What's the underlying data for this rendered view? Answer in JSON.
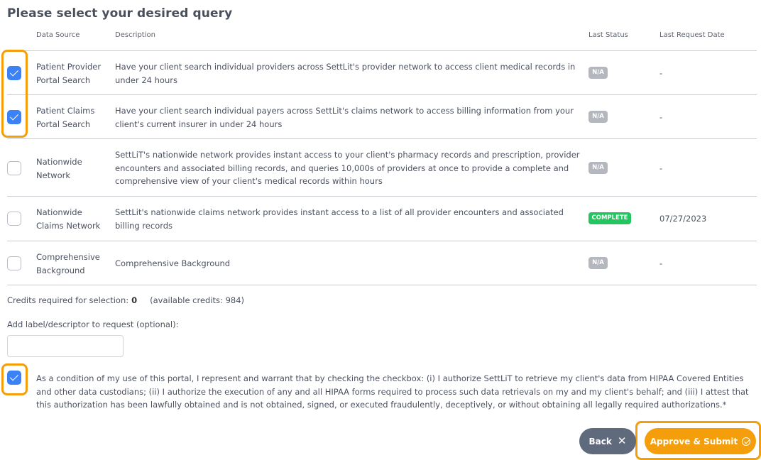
{
  "page": {
    "title": "Please select your desired query"
  },
  "table": {
    "headers": {
      "data_source": "Data Source",
      "description": "Description",
      "last_status": "Last Status",
      "last_request_date": "Last Request Date"
    },
    "rows": [
      {
        "data_source": "Patient Provider Portal Search",
        "description": "Have your client search individual providers across SettLit's provider network to access client medical records in under 24 hours",
        "status": "N/A",
        "date": "-",
        "checked": true
      },
      {
        "data_source": "Patient Claims Portal Search",
        "description": "Have your client search individual payers across SettLit's claims network to access billing information from your client's current insurer in under 24 hours",
        "status": "N/A",
        "date": "-",
        "checked": true
      },
      {
        "data_source": "Nationwide Network",
        "description": "SettLiT's nationwide network provides instant access to your client's pharmacy records and prescription, provider encounters and associated billing records, and queries 10,000s of providers at once to provide a complete and comprehensive view of your client's medical records within hours",
        "status": "N/A",
        "date": "-",
        "checked": false
      },
      {
        "data_source": "Nationwide Claims Network",
        "description": "SettLit's nationwide claims network provides instant access to a list of all provider encounters and associated billing records",
        "status": "COMPLETE",
        "date": "07/27/2023",
        "checked": false
      },
      {
        "data_source": "Comprehensive Background",
        "description": "Comprehensive Background",
        "status": "N/A",
        "date": "-",
        "checked": false
      }
    ]
  },
  "credits": {
    "label": "Credits required for selection:",
    "value": "0",
    "available": "(available credits: 984)"
  },
  "label_field": {
    "label": "Add label/descriptor to request (optional):",
    "value": ""
  },
  "authorization": {
    "checked": true,
    "text": "As a condition of my use of this portal, I represent and warrant that by checking the checkbox: (i) I authorize SettLiT to retrieve my client's data from HIPAA Covered Entities and other data custodians; (ii) I authorize the execution of any and all HIPAA forms required to process such data retrievals on my and my client's behalf; and (iii) I attest that this authorization has been lawfully obtained and is not obtained, signed, or executed fraudulently, deceptively, or without obtaining all legally required authorizations.*"
  },
  "buttons": {
    "back": "Back",
    "submit": "Approve & Submit"
  },
  "colors": {
    "accent": "#f59e0b",
    "checkbox": "#3b82f6",
    "status_na": "#b4b7bd",
    "status_complete": "#22c55e",
    "back_button": "#5f6b7c"
  },
  "icons": {
    "back": "close-icon",
    "submit": "check-circle-icon"
  }
}
